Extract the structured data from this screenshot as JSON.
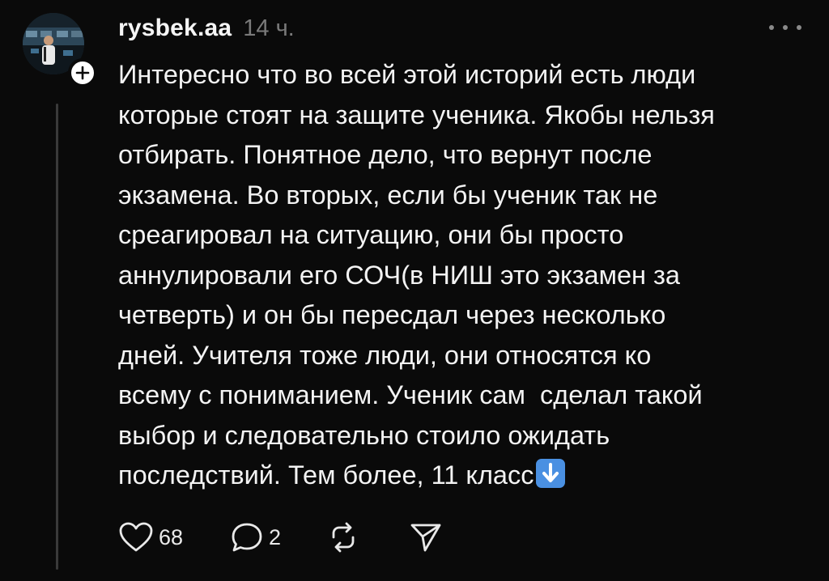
{
  "post": {
    "username": "rysbek.aa",
    "time": "14 ч.",
    "text_lines": [
      "Интересно что во всей этой историй есть люди",
      "которые стоят на защите ученика. Якобы нельзя",
      "отбирать. Понятное дело, что вернут после",
      "экзамена. Во вторых, если бы ученик так не",
      "среагировал на ситуацию, они бы просто",
      "аннулировали его СОЧ(в НИШ это экзамен за",
      "четверть) и он бы пересдал через несколько",
      "дней. Учителя тоже люди, они относятся ко",
      "всему с пониманием. Ученик сам  сделал такой",
      "выбор и следовательно стоило ожидать",
      "последствий. Тем более, 11 класс"
    ],
    "trailing_emoji": "down-arrow-emoji",
    "likes": "68",
    "replies": "2"
  },
  "icons": {
    "more": "more-dots-icon",
    "follow": "plus-icon",
    "like": "heart-icon",
    "reply": "comment-bubble-icon",
    "repost": "repost-icon",
    "share": "send-icon"
  },
  "colors": {
    "background": "#0a0a0a",
    "text": "#f3f3f3",
    "muted": "#7a7a7a",
    "emoji_blue": "#4a90e2"
  }
}
